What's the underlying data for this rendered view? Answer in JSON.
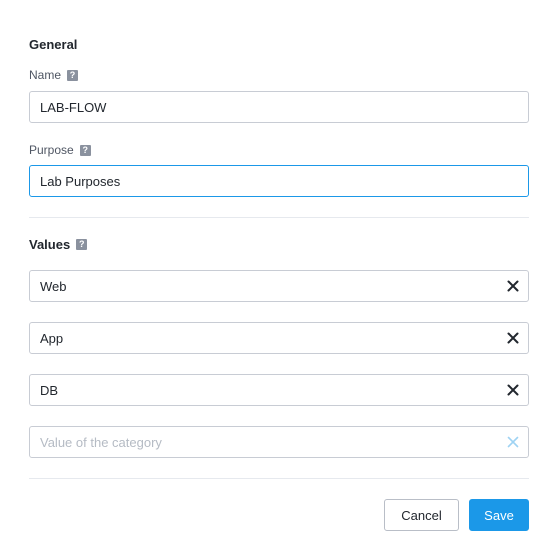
{
  "general": {
    "title": "General",
    "name": {
      "label": "Name",
      "help": "?",
      "value": "LAB-FLOW"
    },
    "purpose": {
      "label": "Purpose",
      "help": "?",
      "value": "Lab Purposes"
    }
  },
  "values": {
    "title": "Values",
    "help": "?",
    "items": [
      {
        "value": "Web"
      },
      {
        "value": "App"
      },
      {
        "value": "DB"
      }
    ],
    "new_item": {
      "value": "",
      "placeholder": "Value of the category"
    }
  },
  "actions": {
    "cancel_label": "Cancel",
    "save_label": "Save"
  },
  "colors": {
    "accent": "#1b98e8",
    "remove_icon": "#22272e",
    "remove_icon_disabled": "#9fd3f3"
  }
}
